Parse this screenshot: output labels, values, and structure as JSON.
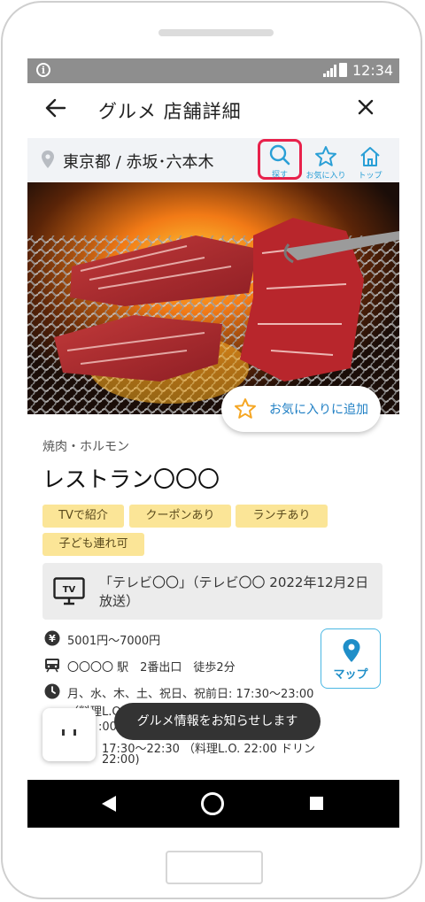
{
  "status_bar": {
    "time": "12:34"
  },
  "header": {
    "title": "グルメ 店舗詳細"
  },
  "location": {
    "text": "東京都 / 赤坂･六本木"
  },
  "nav": {
    "search_label": "探す",
    "favorites_label": "お気に入り",
    "top_label": "トップ"
  },
  "hero": {
    "favorite_add_label": "お気に入りに追加"
  },
  "restaurant": {
    "category": "焼肉・ホルモン",
    "name": "レストラン〇〇〇",
    "tags": [
      "TVで紹介",
      "クーポンあり",
      "ランチあり",
      "子ども連れ可"
    ],
    "tv_note": "「テレビ〇〇」（テレビ〇〇 2022年12月2日放送）",
    "price": "5001円～7000円",
    "access": "〇〇〇〇 駅　2番出口　徒歩2分",
    "hours_line1": "月、水、木、土、祝日、祝前日: 17:30～23:00",
    "hours_line2": "（料理L.O.",
    "hours_line3": ":00",
    "hours_line4": "17:30～22:30 （料理L.O. 22:00 ドリン",
    "hours_line5": "22:00)"
  },
  "map_button": {
    "label": "マップ"
  },
  "toast": {
    "text": "グルメ情報をお知らせします"
  },
  "colors": {
    "accent": "#2a9fd6",
    "highlight": "#e8214b",
    "tag": "#fbe597"
  }
}
